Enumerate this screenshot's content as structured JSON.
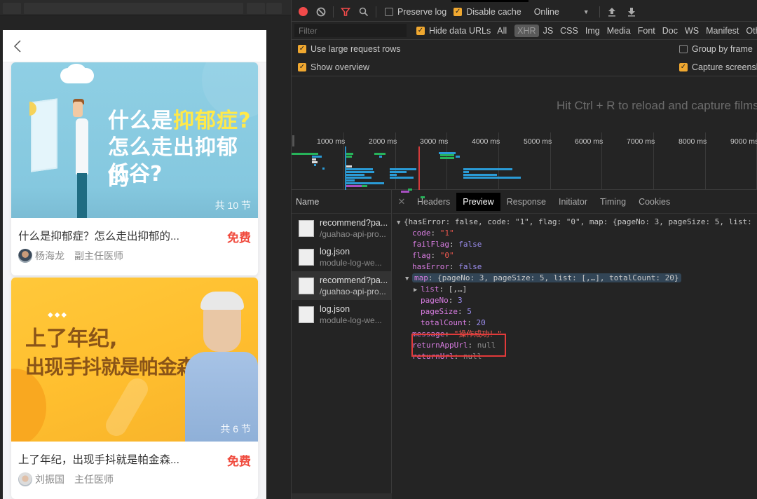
{
  "phone": {
    "back_icon": "chevron-left-icon",
    "courses": [
      {
        "image_headline_1_prefix": "什么是",
        "image_headline_1_highlight": "抑郁症?",
        "image_headline_2": "怎么走出抑郁的",
        "image_headline_3": "低谷?",
        "lesson_count": "共 10 节",
        "title": "什么是抑郁症？怎么走出抑郁的...",
        "price": "免费",
        "doctor_name": "杨海龙",
        "doctor_title": "副主任医师"
      },
      {
        "image_dots": "◆◆◆",
        "image_headline_1": "上了年纪,",
        "image_headline_2": "出现手抖就是帕金森吗?",
        "lesson_count": "共 6 节",
        "title": "上了年纪，出现手抖就是帕金森...",
        "price": "免费",
        "doctor_name": "刘振国",
        "doctor_title": "主任医师"
      }
    ],
    "colors": {
      "price": "#f04a3d",
      "card1_bg": "#8fcfe4",
      "card2_bg": "#ffc83a"
    }
  },
  "devtools": {
    "toolbar": {
      "record_icon": "record-icon",
      "clear_icon": "clear-icon",
      "filter_icon": "filter-icon",
      "search_icon": "search-icon",
      "preserve_log": {
        "label": "Preserve log",
        "checked": false
      },
      "disable_cache": {
        "label": "Disable cache",
        "checked": true
      },
      "throttling": "Online",
      "upload_icon": "import-har-icon",
      "download_icon": "export-har-icon"
    },
    "filter_bar": {
      "placeholder": "Filter",
      "hide_data_urls": {
        "label": "Hide data URLs",
        "checked": true
      },
      "types": [
        "All",
        "XHR",
        "JS",
        "CSS",
        "Img",
        "Media",
        "Font",
        "Doc",
        "WS",
        "Manifest",
        "Other"
      ],
      "active_type": "XHR"
    },
    "settings": {
      "use_large_rows": {
        "label": "Use large request rows",
        "checked": true
      },
      "show_overview": {
        "label": "Show overview",
        "checked": true
      },
      "group_by_frame": {
        "label": "Group by frame",
        "checked": false
      },
      "capture_screenshots": {
        "label": "Capture screenshots",
        "checked": true
      }
    },
    "filmstrip_message": "Hit Ctrl + R to reload and capture filmstrip.",
    "overview": {
      "ticks": [
        "1000 ms",
        "2000 ms",
        "3000 ms",
        "4000 ms",
        "5000 ms",
        "6000 ms",
        "7000 ms",
        "8000 ms",
        "9000 ms"
      ]
    },
    "requests_header": "Name",
    "requests": [
      {
        "name": "recommend?pa...",
        "url": "/guahao-api-pro...",
        "selected": false
      },
      {
        "name": "log.json",
        "url": "module-log-we...",
        "selected": false
      },
      {
        "name": "recommend?pa...",
        "url": "/guahao-api-pro...",
        "selected": true
      },
      {
        "name": "log.json",
        "url": "module-log-we...",
        "selected": false
      }
    ],
    "detail_tabs": [
      "Headers",
      "Preview",
      "Response",
      "Initiator",
      "Timing",
      "Cookies"
    ],
    "active_detail_tab": "Preview",
    "preview": {
      "summary": "{hasError: false, code: \"1\", flag: \"0\", map: {pageNo: 3, pageSize: 5, list:",
      "code": "\"1\"",
      "failFlag": "false",
      "flag": "\"0\"",
      "hasError": "false",
      "map_summary": "{pageNo: 3, pageSize: 5, list: [,…], totalCount: 20}",
      "list": "[,…]",
      "pageNo": "3",
      "pageSize": "5",
      "totalCount": "20",
      "message": "\"操作成功！\"",
      "returnAppUrl": "null",
      "returnUrl": "null"
    },
    "colors": {
      "record": "#f14a4a",
      "checkbox": "#f0a830",
      "highlight_box": "#e23a3a"
    }
  }
}
